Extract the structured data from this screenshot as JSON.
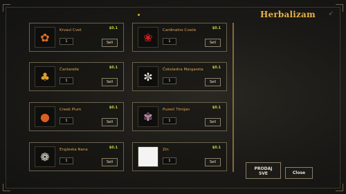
{
  "header": {
    "title": "Herbalizam"
  },
  "colors": {
    "accent": "#e9b347",
    "price": "#c7d23a",
    "item_name": "#e0a558"
  },
  "items": [
    {
      "name": "Krvavi Cvet",
      "price": "$0.1",
      "qty": "1",
      "sell": "Sell",
      "icon": "red-flower-icon"
    },
    {
      "name": "Cardinalno Cveće",
      "price": "$0.1",
      "qty": "1",
      "sell": "Sell",
      "icon": "cardinal-flower-icon"
    },
    {
      "name": "Čantarelle",
      "price": "$0.1",
      "qty": "1",
      "sell": "Sell",
      "icon": "mushroom-icon"
    },
    {
      "name": "Čokoladna Margareta",
      "price": "$0.1",
      "qty": "1",
      "sell": "Sell",
      "icon": "daisy-icon"
    },
    {
      "name": "Creek Plum",
      "price": "$0.1",
      "qty": "1",
      "sell": "Sell",
      "icon": "plum-icon"
    },
    {
      "name": "Puzeći Timijan",
      "price": "$0.1",
      "qty": "1",
      "sell": "Sell",
      "icon": "thyme-icon"
    },
    {
      "name": "Engleska Nana",
      "price": "$0.1",
      "qty": "1",
      "sell": "Sell",
      "icon": "mint-icon"
    },
    {
      "name": "Zin",
      "price": "$0.1",
      "qty": "1",
      "sell": "Sell",
      "icon": "missing-image-icon"
    }
  ],
  "footer": {
    "sell_all_line1": "PRODAJ",
    "sell_all_line2": "SVE",
    "close": "Close"
  }
}
